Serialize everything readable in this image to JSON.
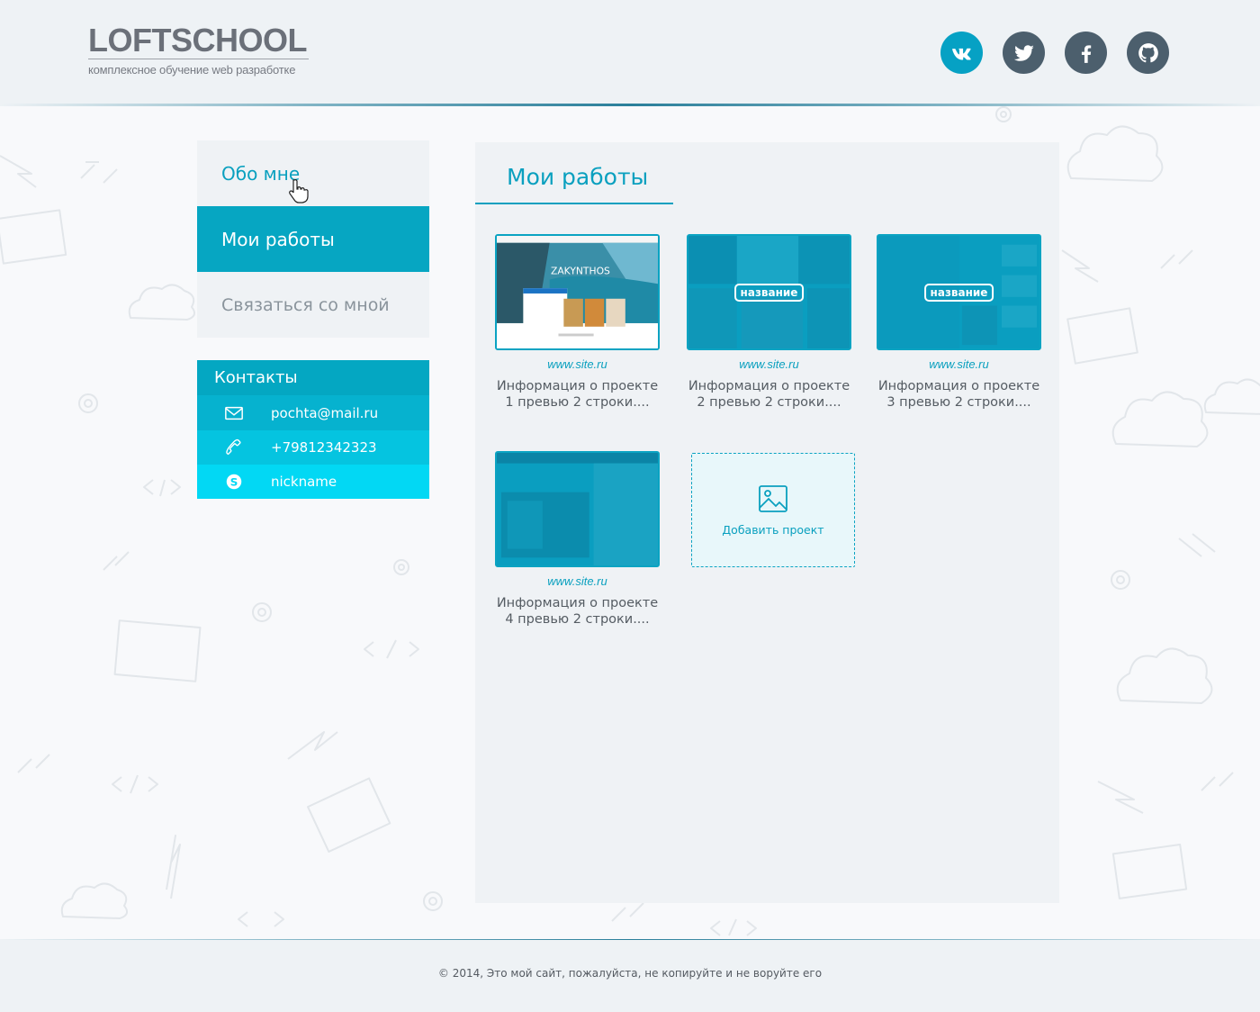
{
  "header": {
    "logo_title": "LOFTSCHOOL",
    "logo_subtitle": "комплексное обучение web разработке",
    "socials": [
      {
        "name": "vk",
        "icon": "vk-icon",
        "color": "#06a1c4"
      },
      {
        "name": "twitter",
        "icon": "twitter-icon",
        "color": "#4c5f6d"
      },
      {
        "name": "facebook",
        "icon": "facebook-icon",
        "color": "#4c5f6d"
      },
      {
        "name": "github",
        "icon": "github-icon",
        "color": "#4c5f6d"
      }
    ]
  },
  "nav": {
    "items": [
      {
        "label": "Обо мне",
        "state": "hover"
      },
      {
        "label": "Мои работы",
        "state": "active"
      },
      {
        "label": "Связаться со мной",
        "state": "default"
      }
    ]
  },
  "contacts": {
    "title": "Контакты",
    "email": "pochta@mail.ru",
    "phone": "+79812342323",
    "skype": "nickname"
  },
  "main": {
    "title": "Мои работы",
    "projects": [
      {
        "site": "www.site.ru",
        "info_line1": "Информация о проекте",
        "info_line2": "1 превью 2 строки....",
        "thumb_title": "ZAKYNTHOS"
      },
      {
        "site": "www.site.ru",
        "info_line1": "Информация о проекте",
        "info_line2": "2 превью 2 строки....",
        "badge": "название"
      },
      {
        "site": "www.site.ru",
        "info_line1": "Информация о проекте",
        "info_line2": "3 превью 2 строки....",
        "badge": "название"
      },
      {
        "site": "www.site.ru",
        "info_line1": "Информация о проекте",
        "info_line2": "4 превью 2 строки...."
      }
    ],
    "add_project_label": "Добавить проект"
  },
  "footer": {
    "copyright": "© 2014, Это мой сайт, пожалуйста, не копируйте и не воруйте его"
  },
  "colors": {
    "accent": "#0aa0bf",
    "active_nav": "#06a6c2",
    "background": "#f8f9fb",
    "panel": "#eff2f5"
  }
}
